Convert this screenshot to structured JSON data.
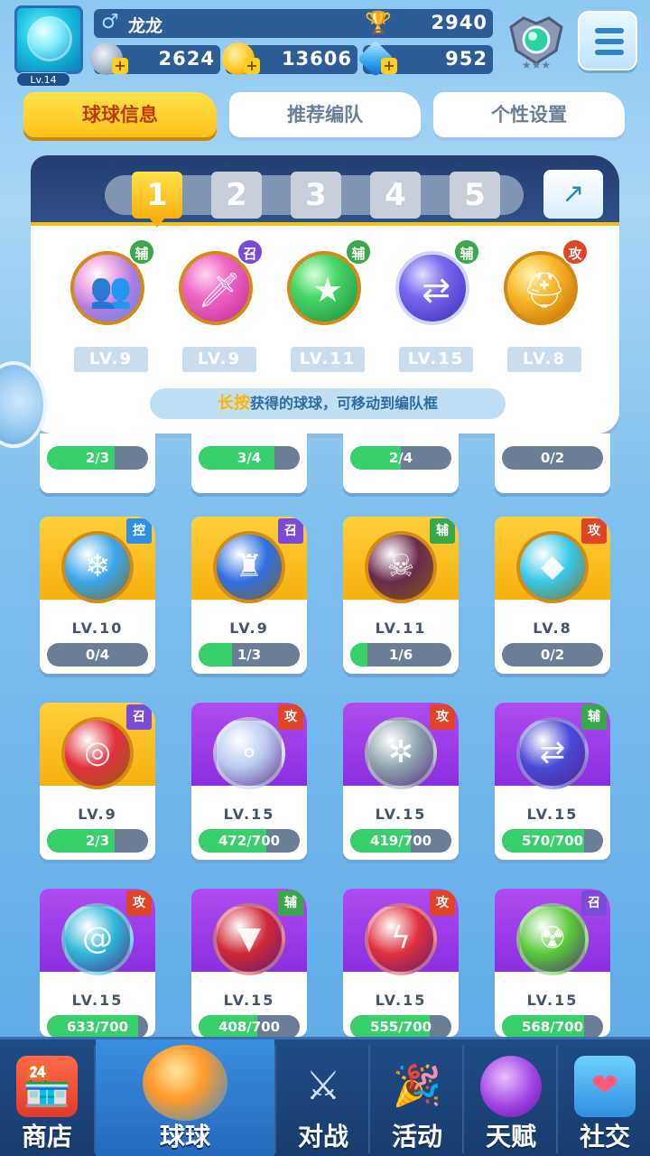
{
  "player": {
    "avatar_level": "Lv.14",
    "gender_icon": "male-icon",
    "name": "龙龙",
    "trophies": "2940"
  },
  "resources": [
    {
      "icon": "stamina-star-icon",
      "value": "2624"
    },
    {
      "icon": "gold-coin-icon",
      "value": "13606"
    },
    {
      "icon": "diamond-gem-icon",
      "value": "952"
    }
  ],
  "tabs": [
    "球球信息",
    "推荐编队",
    "个性设置"
  ],
  "team": {
    "slots": [
      "1",
      "2",
      "3",
      "4",
      "5"
    ],
    "selected_slot": "1",
    "balls": [
      {
        "tag": "辅",
        "tag_color": "#3aa84a",
        "level": "LV.9",
        "glyph": "figures-icon",
        "color": "#c07bd8"
      },
      {
        "tag": "召",
        "tag_color": "#7a4bd6",
        "level": "LV.9",
        "glyph": "dagger-icon",
        "color": "#e04cb0"
      },
      {
        "tag": "辅",
        "tag_color": "#3aa84a",
        "level": "LV.11",
        "glyph": "star-arrow-icon",
        "color": "#2fbf5a"
      },
      {
        "tag": "辅",
        "tag_color": "#3aa84a",
        "level": "LV.15",
        "glyph": "swap-arrow-icon",
        "color": "#5a4ae0"
      },
      {
        "tag": "攻",
        "tag_color": "#e0452a",
        "level": "LV.8",
        "glyph": "knight-helmet-icon",
        "color": "#f0a21c"
      }
    ],
    "hint_strong": "长按",
    "hint_rest": "获得的球球，可移动到编队框"
  },
  "grid": {
    "clipped_row": [
      {
        "progress_text": "2/3",
        "fill": 0.67
      },
      {
        "progress_text": "3/4",
        "fill": 0.75
      },
      {
        "progress_text": "2/4",
        "fill": 0.5
      },
      {
        "progress_text": "0/2",
        "fill": 0
      }
    ],
    "rows": [
      [
        {
          "tag": "控",
          "tag_color": "#2f8fe0",
          "level": "LV.10",
          "progress_text": "0/4",
          "fill": 0,
          "theme": "gold",
          "ball_color": "#3aa5ea",
          "glyph": "snowflake-icon"
        },
        {
          "tag": "召",
          "tag_color": "#7a4bd6",
          "level": "LV.9",
          "progress_text": "1/3",
          "fill": 0.33,
          "theme": "gold",
          "ball_color": "#2f6fe0",
          "glyph": "ice-castle-icon"
        },
        {
          "tag": "辅",
          "tag_color": "#3aa84a",
          "level": "LV.11",
          "progress_text": "1/6",
          "fill": 0.17,
          "theme": "gold",
          "ball_color": "#6a2a4a",
          "glyph": "skull-icon"
        },
        {
          "tag": "攻",
          "tag_color": "#e0452a",
          "level": "LV.8",
          "progress_text": "0/2",
          "fill": 0,
          "theme": "gold",
          "ball_color": "#37c8e8",
          "glyph": "crystal-icon"
        }
      ],
      [
        {
          "tag": "召",
          "tag_color": "#7a4bd6",
          "level": "LV.9",
          "progress_text": "2/3",
          "fill": 0.67,
          "theme": "gold",
          "ball_color": "#e0303c",
          "glyph": "cannon-icon"
        },
        {
          "tag": "攻",
          "tag_color": "#e0452a",
          "level": "LV.15",
          "progress_text": "472/700",
          "fill": 0.67,
          "theme": "purple",
          "ball_color": "#b8c8f0",
          "glyph": "bubbles-icon"
        },
        {
          "tag": "攻",
          "tag_color": "#e0452a",
          "level": "LV.15",
          "progress_text": "419/700",
          "fill": 0.6,
          "theme": "purple",
          "ball_color": "#8ea3ad",
          "glyph": "fan-blade-icon"
        },
        {
          "tag": "辅",
          "tag_color": "#3aa84a",
          "level": "LV.15",
          "progress_text": "570/700",
          "fill": 0.81,
          "theme": "purple",
          "ball_color": "#4a4ad8",
          "glyph": "swap-arrow-icon"
        }
      ],
      [
        {
          "tag": "攻",
          "tag_color": "#e0452a",
          "level": "LV.15",
          "progress_text": "633/700",
          "fill": 0.9,
          "theme": "purple",
          "ball_color": "#2fb6d8",
          "glyph": "vortex-icon"
        },
        {
          "tag": "辅",
          "tag_color": "#3aa84a",
          "level": "LV.15",
          "progress_text": "408/700",
          "fill": 0.58,
          "theme": "purple",
          "ball_color": "#d02838",
          "glyph": "fangs-icon"
        },
        {
          "tag": "攻",
          "tag_color": "#e0452a",
          "level": "LV.15",
          "progress_text": "555/700",
          "fill": 0.79,
          "theme": "purple",
          "ball_color": "#e0303c",
          "glyph": "lightning-icon"
        },
        {
          "tag": "召",
          "tag_color": "#7a4bd6",
          "level": "LV.15",
          "progress_text": "568/700",
          "fill": 0.81,
          "theme": "purple",
          "ball_color": "#58c83a",
          "glyph": "radiation-icon"
        }
      ]
    ]
  },
  "nav": [
    {
      "label": "商店",
      "icon": "shop-icon"
    },
    {
      "label": "球球",
      "icon": "ball-cannon-icon",
      "active": true
    },
    {
      "label": "对战",
      "icon": "crossed-swords-icon"
    },
    {
      "label": "活动",
      "icon": "party-popper-icon"
    },
    {
      "label": "天赋",
      "icon": "planet-icon"
    },
    {
      "label": "社交",
      "icon": "chat-heart-icon"
    }
  ]
}
